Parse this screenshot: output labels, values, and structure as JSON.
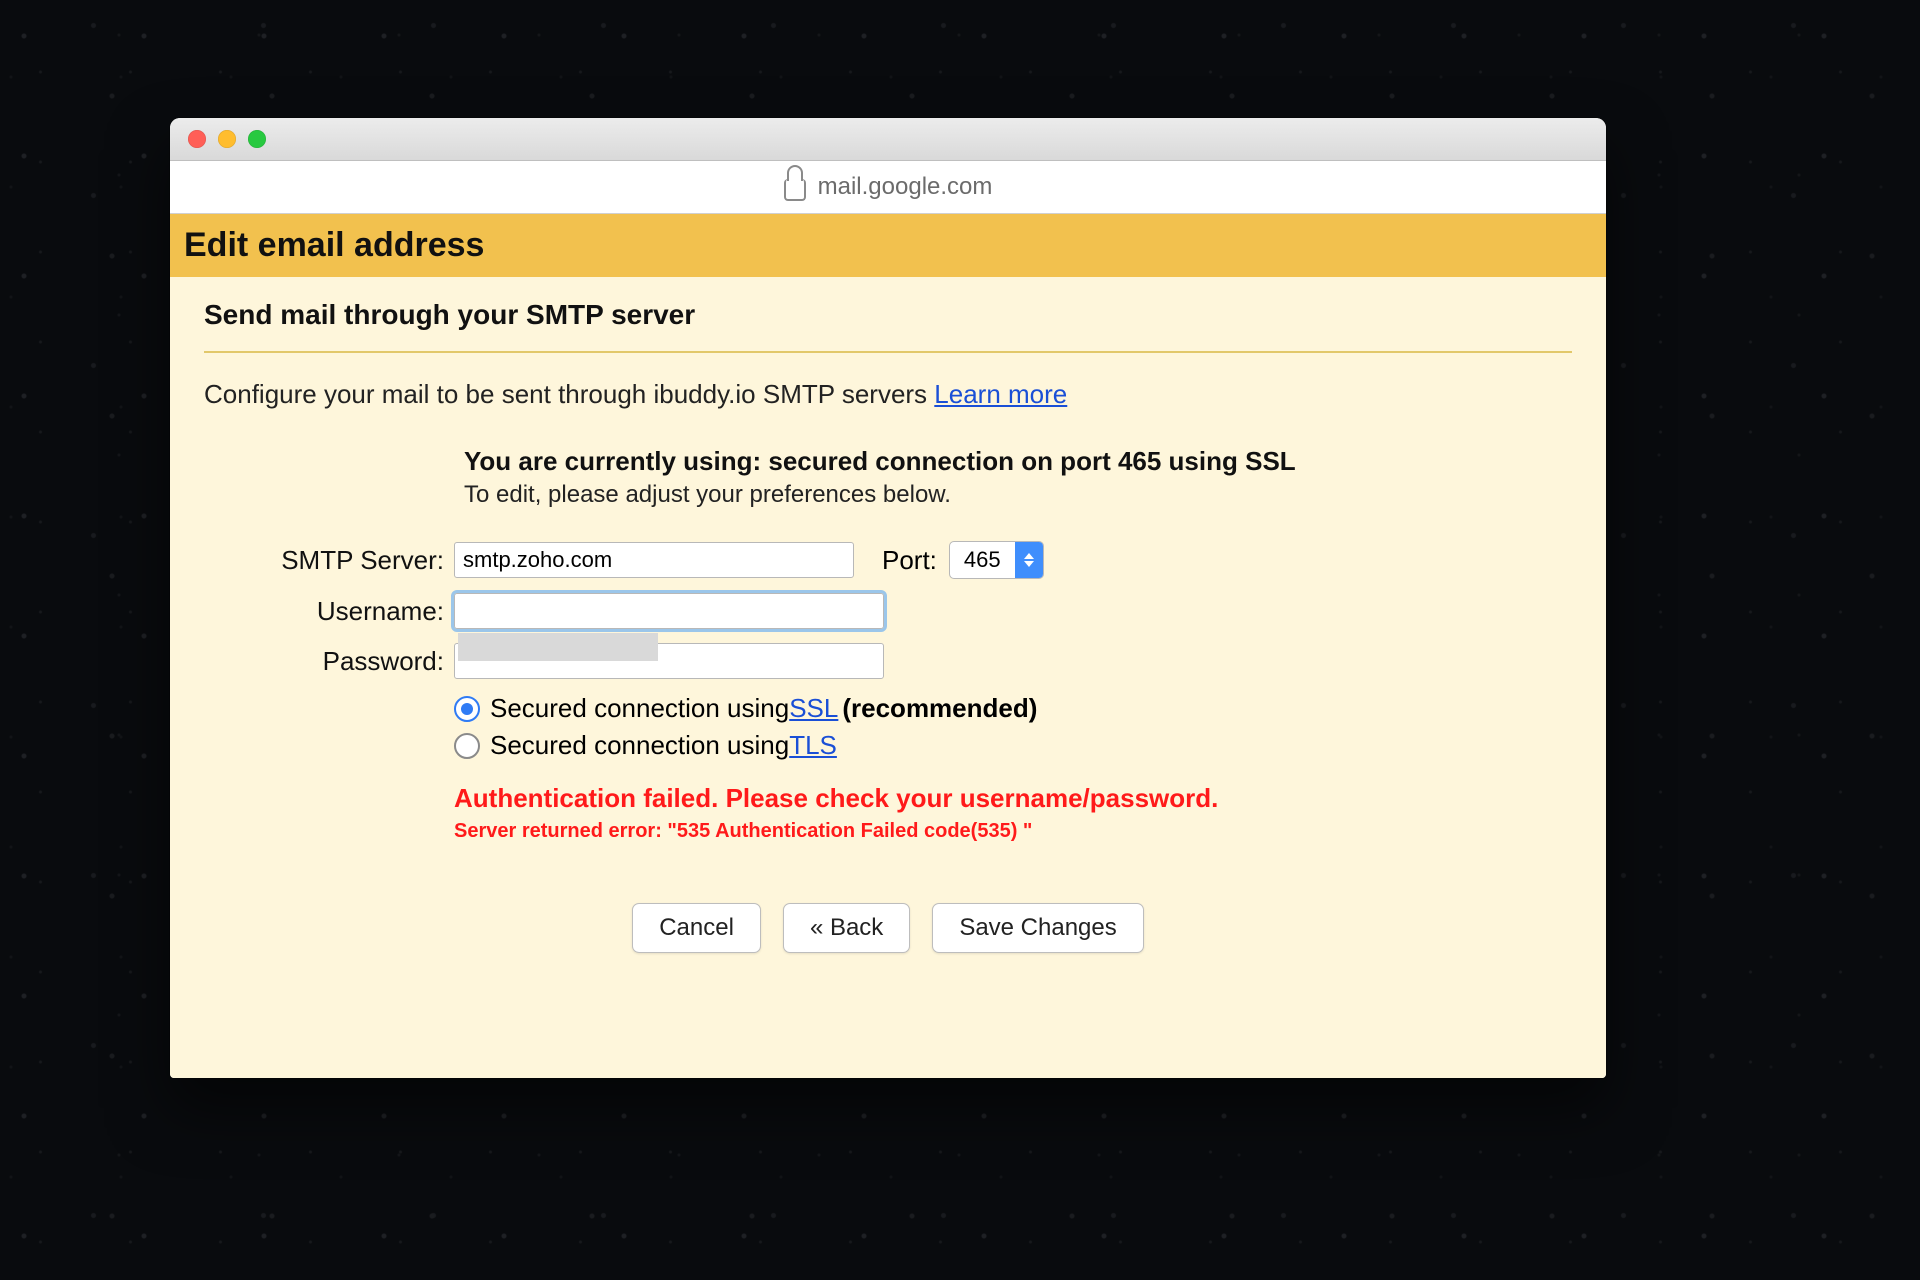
{
  "window": {
    "address": "mail.google.com"
  },
  "banner": {
    "title": "Edit email address"
  },
  "section": {
    "subtitle": "Send mail through your SMTP server",
    "description_prefix": "Configure your mail to be sent through ibuddy.io SMTP servers ",
    "learn_more": "Learn more"
  },
  "status": {
    "line": "You are currently using: secured connection on port 465 using SSL",
    "hint": "To edit, please adjust your preferences below."
  },
  "form": {
    "smtp_label": "SMTP Server:",
    "smtp_value": "smtp.zoho.com",
    "port_label": "Port:",
    "port_value": "465",
    "username_label": "Username:",
    "username_value": "",
    "password_label": "Password:",
    "password_value": ""
  },
  "security": {
    "ssl_prefix": "Secured connection using ",
    "ssl_link": "SSL",
    "ssl_suffix": " (recommended)",
    "tls_prefix": "Secured connection using ",
    "tls_link": "TLS",
    "selected": "ssl"
  },
  "error": {
    "headline": "Authentication failed. Please check your username/password.",
    "detail": "Server returned error: \"535 Authentication Failed code(535) \""
  },
  "buttons": {
    "cancel": "Cancel",
    "back": "« Back",
    "save": "Save Changes"
  }
}
